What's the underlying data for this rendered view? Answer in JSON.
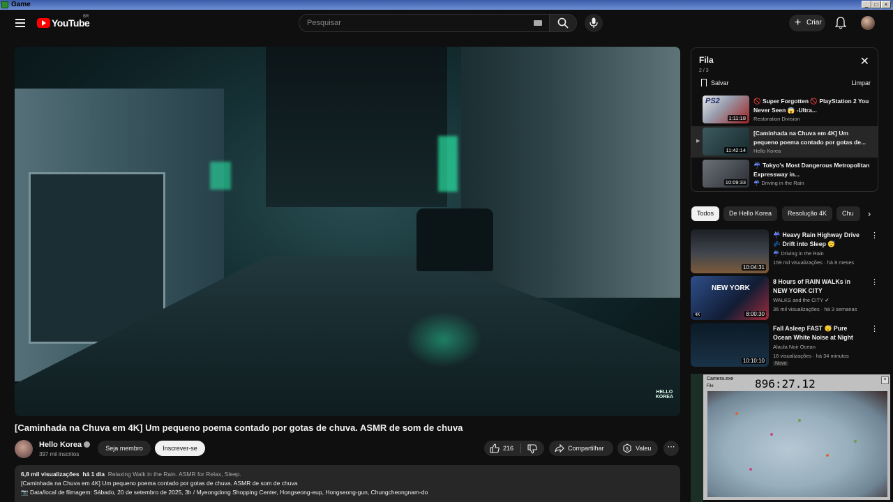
{
  "window": {
    "title": "Game"
  },
  "header": {
    "logo_text": "YouTube",
    "logo_country": "BR",
    "search_placeholder": "Pesquisar",
    "create_label": "Criar"
  },
  "video": {
    "title": "[Caminhada na Chuva em 4K] Um pequeno poema contado por gotas de chuva. ASMR de som de chuva",
    "watermark_line1": "HELLO",
    "watermark_line2": "KOREA",
    "channel_name": "Hello Korea",
    "subscribers": "397 mil inscritos",
    "member_label": "Seja membro",
    "subscribe_label": "Inscrever-se",
    "likes": "216",
    "share_label": "Compartilhar",
    "thanks_label": "Valeu",
    "more_label": "⋯"
  },
  "description": {
    "views": "6,8 mil visualizações",
    "age": "há 1 dia",
    "tags": "Relaxing Walk in the Rain. ASMR for Relax, Sleep.",
    "line2": "[Caminhada na Chuva em 4K] Um pequeno poema contado por gotas de chuva. ASMR de som de chuva",
    "line3": "📷 Data/local de filmagem: Sábado, 20 de setembro de 2025, 3h / Myeongdong Shopping Center, Hongseong-eup, Hongseong-gun, Chungcheongnam-do"
  },
  "queue": {
    "title": "Fila",
    "count": "2 / 3",
    "save_label": "Salvar",
    "clear_label": "Limpar",
    "items": [
      {
        "title": "🚫 Super Forgotten 🚫 PlayStation 2 You Never Seen 😱 -Ultra...",
        "channel": "Restoration Division",
        "duration": "1:11:18",
        "active": false
      },
      {
        "title": "[Caminhada na Chuva em 4K] Um pequeno poema contado por gotas de...",
        "channel": "Hello Korea",
        "duration": "11:42:14",
        "active": true
      },
      {
        "title": "☔ Tokyo's Most Dangerous Metropolitan Expressway in...",
        "channel": "☔ Driving in the Rain",
        "duration": "10:09:33",
        "active": false
      }
    ]
  },
  "chips": [
    "Todos",
    "De Hello Korea",
    "Resolução 4K",
    "Chu"
  ],
  "recommendations": [
    {
      "title": "☔ Heavy Rain Highway Drive 💤 Drift into Sleep 😴",
      "channel": "☔ Driving in the Rain",
      "meta": "159 mil visualizações · há 8 meses",
      "duration": "10:04:31",
      "badge": ""
    },
    {
      "title": "8 Hours of RAIN WALKs in NEW YORK CITY",
      "channel": "WALKS and the CITY ✔",
      "meta": "36 mil visualizações · há 3 semanas",
      "duration": "8:00:30",
      "badge": "",
      "thumb_text": "NEW YORK"
    },
    {
      "title": "Fall Asleep FAST 😴 Pure Ocean White Noise at Night (8...",
      "channel": "Alaula Noir Ocean",
      "meta": "16 visualizações · há 34 minutos",
      "duration": "10:10:10",
      "badge": "Novo"
    }
  ],
  "overlay": {
    "app_name": "Camera.exe",
    "menu": "File",
    "timer": "896:27.12"
  },
  "colors": {
    "brand_red": "#ff0000",
    "bg": "#0f0f0f",
    "surface": "#272727",
    "neon": "#2bffb3"
  }
}
